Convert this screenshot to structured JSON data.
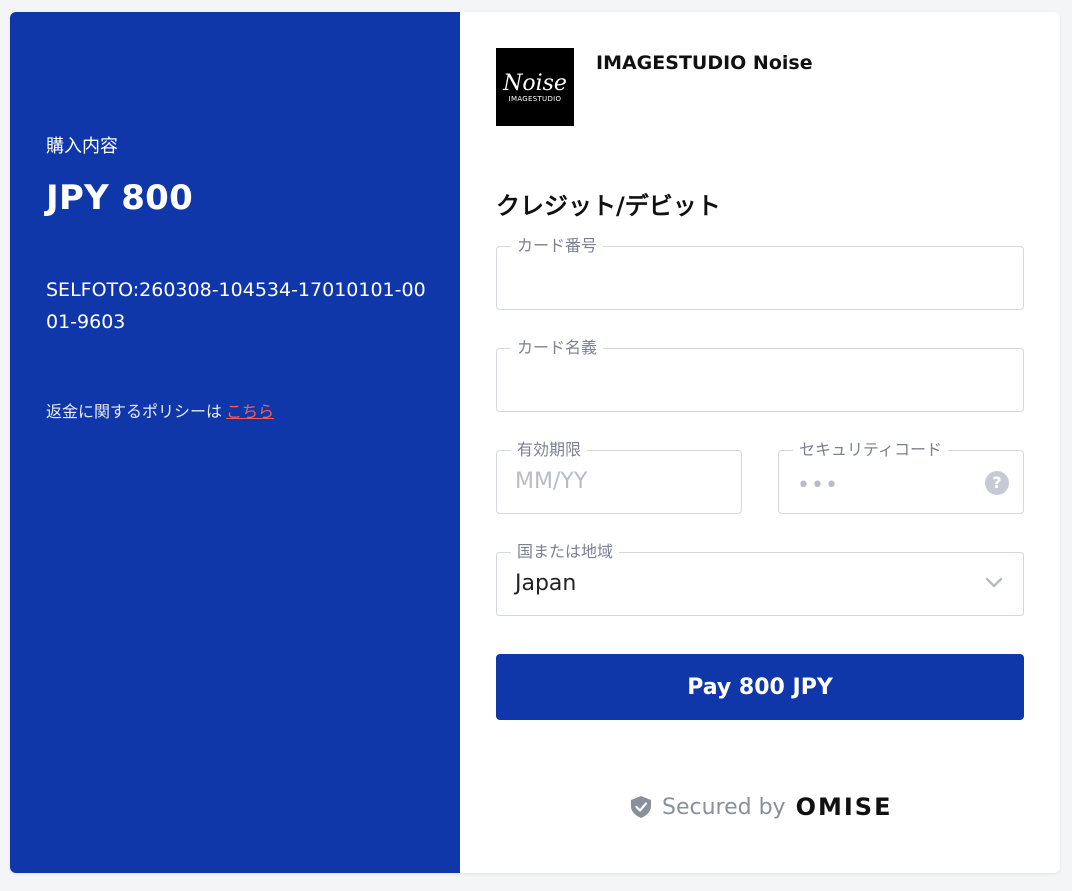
{
  "summary": {
    "label": "購入内容",
    "amount": "JPY 800",
    "reference": "SELFOTO:260308-104534-17010101-0001-9603",
    "refund_text": "返金に関するポリシーは",
    "refund_link": "こちら"
  },
  "merchant": {
    "name": "IMAGESTUDIO Noise",
    "logo_text_main": "Noise",
    "logo_text_sub": "IMAGESTUDIO"
  },
  "payment": {
    "method_title": "クレジット/デビット",
    "fields": {
      "card_number_label": "カード番号",
      "card_name_label": "カード名義",
      "expiry_label": "有効期限",
      "expiry_placeholder": "MM/YY",
      "security_label": "セキュリティコード",
      "security_placeholder": "•••",
      "country_label": "国または地域",
      "country_value": "Japan"
    },
    "pay_button": "Pay 800 JPY"
  },
  "footer": {
    "secured_text": "Secured by",
    "brand": "OMISE"
  },
  "icons": {
    "help": "question-mark",
    "chevron": "chevron-down",
    "shield": "shield-check"
  },
  "colors": {
    "primary": "#0f37a9",
    "link": "#ff5a5a"
  }
}
